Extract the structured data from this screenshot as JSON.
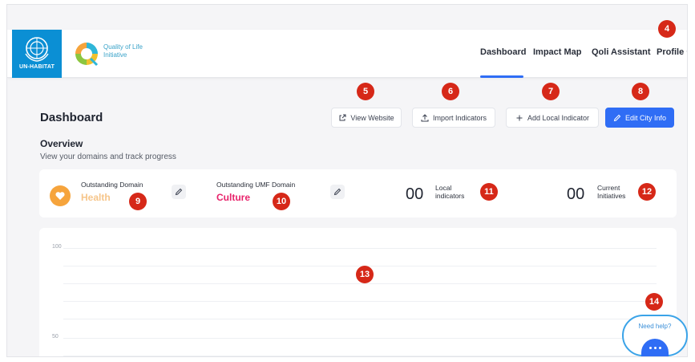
{
  "header": {
    "un_logo_text": "UN-HABITAT",
    "qol_logo_line1": "Quality of Life",
    "qol_logo_line2": "Initiative",
    "nav": {
      "dashboard": "Dashboard",
      "impact_map": "Impact Map",
      "qoli_assistant": "Qoli Assistant",
      "profile": "Profile"
    }
  },
  "page": {
    "title": "Dashboard",
    "buttons": {
      "view_website": "View Website",
      "import_indicators": "Import Indicators",
      "add_local_indicator": "Add Local Indicator",
      "edit_city_info": "Edit City Info"
    },
    "overview": {
      "title": "Overview",
      "subtitle": "View your domains and track progress"
    }
  },
  "stats": {
    "outstanding_domain": {
      "label": "Outstanding Domain",
      "value": "Health",
      "color": "#f6a43c"
    },
    "outstanding_umf_domain": {
      "label": "Outstanding UMF Domain",
      "value": "Culture",
      "color": "#e8236b"
    },
    "local_indicators": {
      "count": "00",
      "label": "Local indicators"
    },
    "current_initiatives": {
      "count": "00",
      "label": "Current Initiatives"
    }
  },
  "chart": {
    "y_ticks": [
      "100",
      "50"
    ]
  },
  "help": {
    "label": "Need help?"
  },
  "markers": [
    "4",
    "5",
    "6",
    "7",
    "8",
    "9",
    "10",
    "11",
    "12",
    "13",
    "14"
  ],
  "colors": {
    "accent": "#2f6df5",
    "marker": "#d62818",
    "un_blue": "#0b8fd4"
  }
}
